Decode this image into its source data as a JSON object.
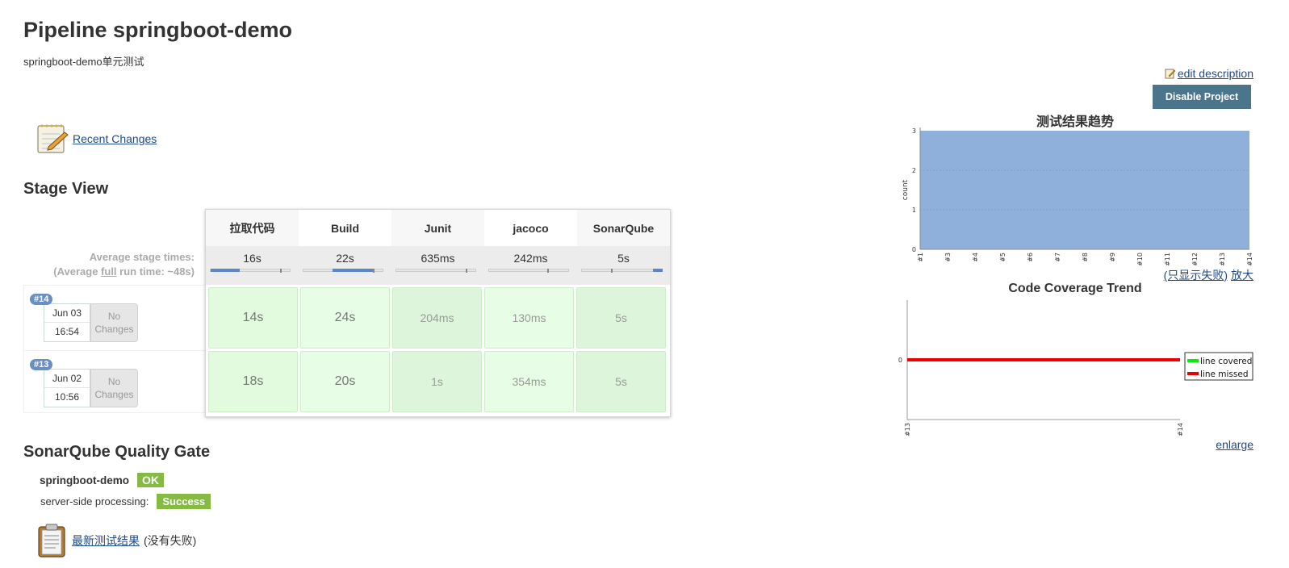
{
  "header": {
    "title": "Pipeline springboot-demo",
    "description": "springboot-demo单元测试",
    "edit_description": "edit description",
    "disable_button": "Disable Project"
  },
  "recent_changes": {
    "label": "Recent Changes",
    "icon": "notepad-icon"
  },
  "stage_view": {
    "heading": "Stage View",
    "avg_label_1": "Average stage times:",
    "avg_label_2a": "(Average ",
    "avg_label_full": "full",
    "avg_label_2b": " run time: ~48s)",
    "stages": [
      {
        "name": "拉取代码",
        "avg": "16s"
      },
      {
        "name": "Build",
        "avg": "22s"
      },
      {
        "name": "Junit",
        "avg": "635ms"
      },
      {
        "name": "jacoco",
        "avg": "242ms"
      },
      {
        "name": "SonarQube",
        "avg": "5s"
      }
    ],
    "builds": [
      {
        "number": "#14",
        "date": "Jun 03",
        "time": "16:54",
        "changes_1": "No",
        "changes_2": "Changes",
        "durations": [
          "14s",
          "24s",
          "204ms",
          "130ms",
          "5s"
        ]
      },
      {
        "number": "#13",
        "date": "Jun 02",
        "time": "10:56",
        "changes_1": "No",
        "changes_2": "Changes",
        "durations": [
          "18s",
          "20s",
          "1s",
          "354ms",
          "5s"
        ]
      }
    ]
  },
  "sonarqube": {
    "heading": "SonarQube Quality Gate",
    "project": "springboot-demo",
    "status": "OK",
    "processing_label": "server-side processing:",
    "processing_status": "Success"
  },
  "latest_results": {
    "link": "最新测试结果",
    "note": "(没有失败)",
    "icon": "clipboard-icon"
  },
  "charts": {
    "test_trend": {
      "title": "测试结果趋势",
      "show_failed": "(只显示失败)",
      "zoom": "放大"
    },
    "coverage_trend": {
      "title": "Code Coverage Trend",
      "enlarge": "enlarge"
    }
  },
  "chart_data": [
    {
      "type": "area",
      "title": "测试结果趋势",
      "xlabel": "",
      "ylabel": "count",
      "ylim": [
        0,
        3
      ],
      "yticks": [
        "0",
        "1",
        "2",
        "3"
      ],
      "categories": [
        "#1",
        "#3",
        "#4",
        "#5",
        "#6",
        "#7",
        "#8",
        "#9",
        "#10",
        "#11",
        "#12",
        "#13",
        "#14"
      ],
      "series": [
        {
          "values": [
            3,
            3,
            3,
            3,
            3,
            3,
            3,
            3,
            3,
            3,
            3,
            3,
            3
          ],
          "color": "#8fb0da"
        }
      ]
    },
    {
      "type": "line",
      "title": "Code Coverage Trend",
      "categories": [
        "#13",
        "#14"
      ],
      "yticks": [
        "0"
      ],
      "legend": "right",
      "series": [
        {
          "name": "line covered",
          "values": [
            0,
            0
          ],
          "color": "#00ee00"
        },
        {
          "name": "line missed",
          "values": [
            0,
            0
          ],
          "color": "#ee0000"
        }
      ]
    }
  ]
}
